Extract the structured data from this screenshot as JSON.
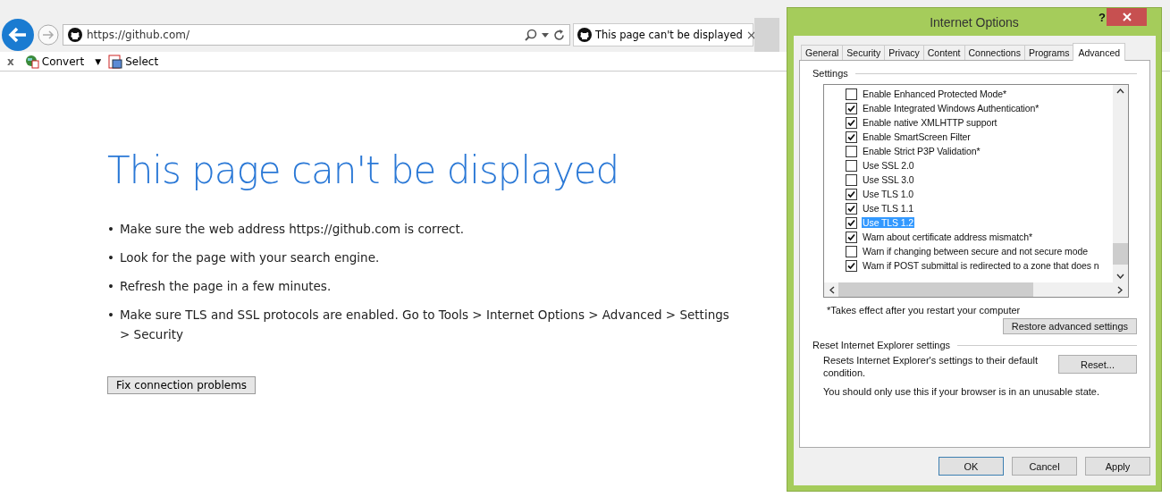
{
  "browser": {
    "address": "https://github.com/",
    "tab": {
      "title": "This page can't be displayed",
      "close": "×"
    },
    "toolbar": [
      {
        "kind": "close",
        "label": "x"
      },
      {
        "kind": "convert",
        "label": "Convert"
      },
      {
        "kind": "caret",
        "label": "▼"
      },
      {
        "kind": "select",
        "label": "Select"
      }
    ]
  },
  "page": {
    "heading": "This page can't be displayed",
    "bullet_mark": "•",
    "bullets": [
      "Make sure the web address https://github.com is correct.",
      "Look for the page with your search engine.",
      "Refresh the page in a few minutes.",
      "Make sure TLS and SSL protocols are enabled. Go to Tools > Internet Options > Advanced > Settings > Security"
    ],
    "button": "Fix connection problems"
  },
  "dialog": {
    "title": "Internet Options",
    "help": "?",
    "tabs": [
      {
        "label": "General",
        "selected": false
      },
      {
        "label": "Security",
        "selected": false
      },
      {
        "label": "Privacy",
        "selected": false
      },
      {
        "label": "Content",
        "selected": false
      },
      {
        "label": "Connections",
        "selected": false
      },
      {
        "label": "Programs",
        "selected": false
      },
      {
        "label": "Advanced",
        "selected": true
      }
    ],
    "settings_label": "Settings",
    "settings": [
      {
        "label": "Enable Enhanced Protected Mode*",
        "checked": false,
        "selected": false
      },
      {
        "label": "Enable Integrated Windows Authentication*",
        "checked": true,
        "selected": false
      },
      {
        "label": "Enable native XMLHTTP support",
        "checked": true,
        "selected": false
      },
      {
        "label": "Enable SmartScreen Filter",
        "checked": true,
        "selected": false
      },
      {
        "label": "Enable Strict P3P Validation*",
        "checked": false,
        "selected": false
      },
      {
        "label": "Use SSL 2.0",
        "checked": false,
        "selected": false
      },
      {
        "label": "Use SSL 3.0",
        "checked": false,
        "selected": false
      },
      {
        "label": "Use TLS 1.0",
        "checked": true,
        "selected": false
      },
      {
        "label": "Use TLS 1.1",
        "checked": true,
        "selected": false
      },
      {
        "label": "Use TLS 1.2",
        "checked": true,
        "selected": true
      },
      {
        "label": "Warn about certificate address mismatch*",
        "checked": true,
        "selected": false
      },
      {
        "label": "Warn if changing between secure and not secure mode",
        "checked": false,
        "selected": false
      },
      {
        "label": "Warn if POST submittal is redirected to a zone that does n",
        "checked": true,
        "selected": false
      }
    ],
    "footnote": "*Takes effect after you restart your computer",
    "restore_button": "Restore advanced settings",
    "reset_label": "Reset Internet Explorer settings",
    "reset_description": "Resets Internet Explorer's settings to their default condition.",
    "reset_button": "Reset...",
    "reset_warning": "You should only use this if your browser is in an unusable state.",
    "buttons": [
      {
        "label": "OK",
        "default": true
      },
      {
        "label": "Cancel",
        "default": false
      },
      {
        "label": "Apply",
        "default": false
      }
    ]
  }
}
